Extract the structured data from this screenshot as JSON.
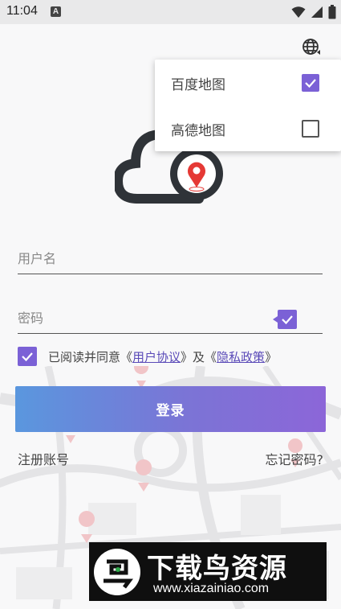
{
  "status_bar": {
    "time": "11:04",
    "notification_letter": "A"
  },
  "map_menu": {
    "items": [
      {
        "label": "百度地图",
        "checked": true
      },
      {
        "label": "高德地图",
        "checked": false
      }
    ]
  },
  "form": {
    "username_placeholder": "用户名",
    "password_placeholder": "密码",
    "agreement_prefix": "已阅读并同意《",
    "user_agreement": "用户协议",
    "agreement_middle": "》及《",
    "privacy_policy": "隐私政策",
    "agreement_suffix": "》",
    "login_label": "登录",
    "register_label": "注册账号",
    "forgot_label": "忘记密码?"
  },
  "watermark": {
    "title": "下载鸟资源",
    "url": "www.xiazainiao.com"
  },
  "colors": {
    "accent": "#7b61d6",
    "gradient_start": "#5a97de",
    "gradient_end": "#8c66d8",
    "marker": "#e53935"
  }
}
